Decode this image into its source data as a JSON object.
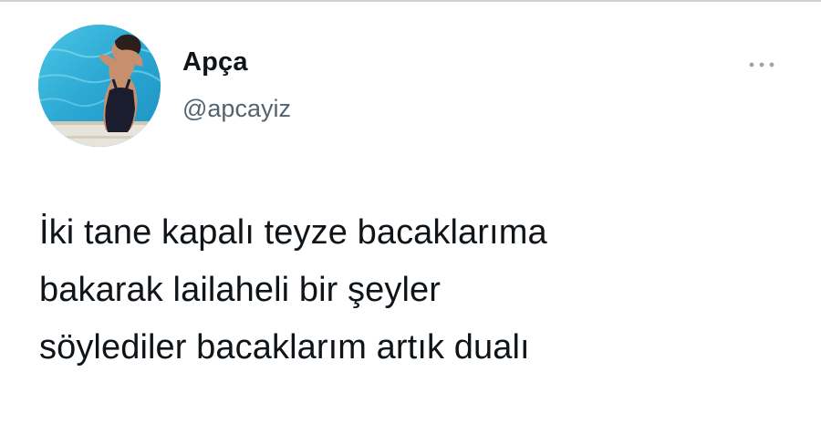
{
  "author": {
    "display_name": "Apça",
    "handle": "@apcayiz",
    "avatar_icon": "profile-photo"
  },
  "tweet": {
    "text": "İki tane kapalı teyze bacaklarıma\nbakarak lailaheli bir şeyler\nsöylediler bacaklarım artık dualı"
  },
  "more_menu": {
    "icon": "more-horizontal-icon"
  },
  "colors": {
    "text_primary": "#0f1419",
    "text_secondary": "#536471",
    "pool_water": "#36b4d8"
  }
}
